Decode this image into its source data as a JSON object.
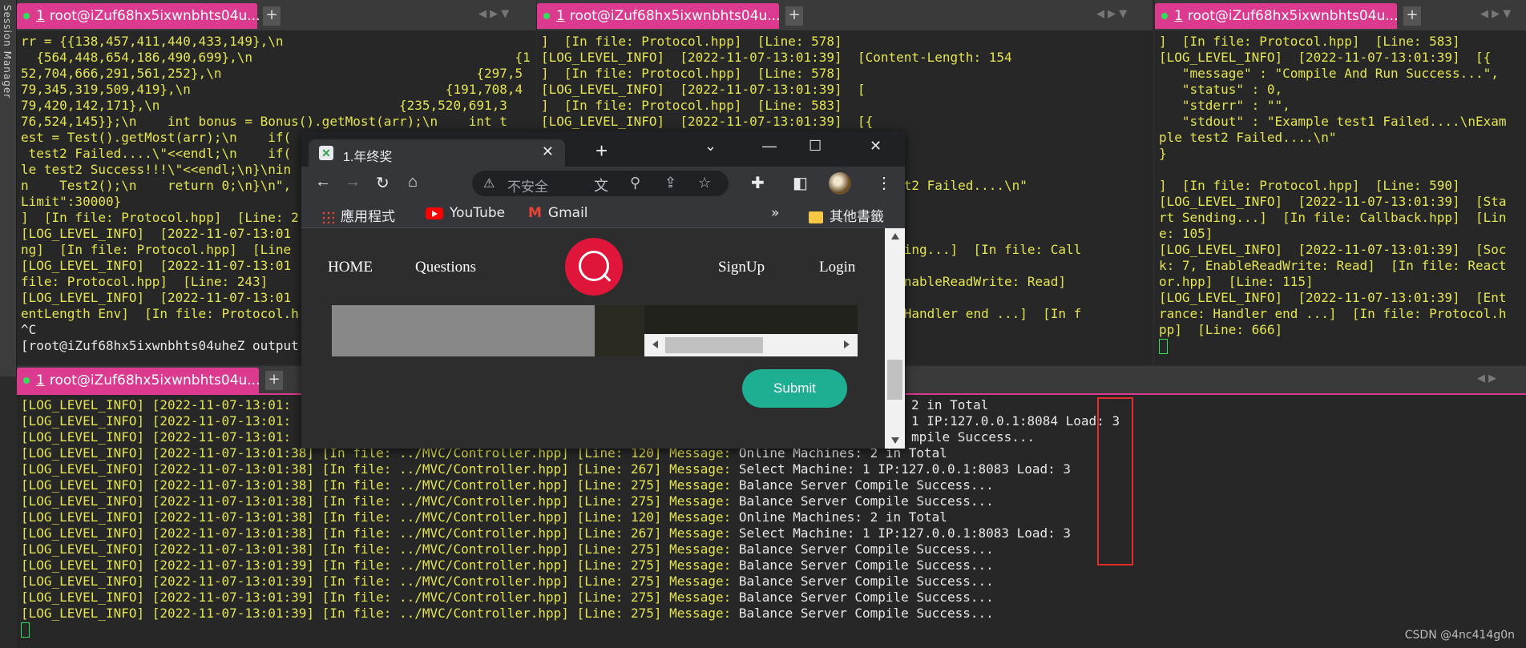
{
  "session_manager": {
    "label": "Session Manager"
  },
  "panes": {
    "top_left": {
      "tab": {
        "index": "1",
        "title": "root@iZuf68hx5ixwnbhts04u..."
      },
      "lines": [
        "rr = {{138,457,411,440,433,149},\\n",
        "  {564,448,654,186,490,699},\\n                                  {1",
        "52,704,666,291,561,252},\\n                                 {297,5",
        "79,345,319,509,419},\\n                                 {191,708,4",
        "79,420,142,171},\\n                               {235,520,691,3",
        "76,524,145}};\\n    int bonus = Bonus().getMost(arr);\\n    int t",
        "est = Test().getMost(arr);\\n    if(",
        " test2 Failed....\\\"<<endl;\\n    if(",
        "le test2 Success!!!\\\"<<endl;\\n}\\nin",
        "n    Test2();\\n    return 0;\\n}\\n\",",
        "Limit\":30000}",
        "]  [In file: Protocol.hpp]  [Line: 2",
        "[LOG_LEVEL_INFO]  [2022-11-07-13:01",
        "ng]  [In file: Protocol.hpp]  [Line",
        "[LOG_LEVEL_INFO]  [2022-11-07-13:01",
        "file: Protocol.hpp]  [Line: 243]",
        "[LOG_LEVEL_INFO]  [2022-11-07-13:01",
        "entLength Env]  [In file: Protocol.h",
        "^C"
      ],
      "prompt": "[root@iZuf68hx5ixwnbhts04uheZ output"
    },
    "top_mid": {
      "tab": {
        "index": "1",
        "title": "root@iZuf68hx5ixwnbhts04u..."
      },
      "lines": [
        "]  [In file: Protocol.hpp]  [Line: 578]",
        "[LOG_LEVEL_INFO]  [2022-11-07-13:01:39]  [Content-Length: 154",
        "]  [In file: Protocol.hpp]  [Line: 578]",
        "[LOG_LEVEL_INFO]  [2022-11-07-13:01:39]  [",
        "]  [In file: Protocol.hpp]  [Line: 583]",
        "[LOG_LEVEL_INFO]  [2022-11-07-13:01:39]  [{",
        "",
        "",
        "",
        "                                        ple test2 Failed....\\n\"",
        "",
        "",
        "",
        "                                        rt Sending...]  [In file: Call",
        "",
        "                                        k: 9, EnableReadWrite: Read]",
        "",
        "                                        rance: Handler end ...]  [In f"
      ]
    },
    "top_right": {
      "tab": {
        "index": "1",
        "title": "root@iZuf68hx5ixwnbhts04u..."
      },
      "lines": [
        "]  [In file: Protocol.hpp]  [Line: 583]",
        "[LOG_LEVEL_INFO]  [2022-11-07-13:01:39]  [{",
        "   \"message\" : \"Compile And Run Success...\",",
        "   \"status\" : 0,",
        "   \"stderr\" : \"\",",
        "   \"stdout\" : \"Example test1 Failed....\\nExam",
        "ple test2 Failed....\\n\"",
        "}",
        "",
        "]  [In file: Protocol.hpp]  [Line: 590]",
        "[LOG_LEVEL_INFO]  [2022-11-07-13:01:39]  [Sta",
        "rt Sending...]  [In file: Callback.hpp]  [Lin",
        "e: 105]",
        "[LOG_LEVEL_INFO]  [2022-11-07-13:01:39]  [Soc",
        "k: 7, EnableReadWrite: Read]  [In file: React",
        "or.hpp]  [Line: 115]",
        "[LOG_LEVEL_INFO]  [2022-11-07-13:01:39]  [Ent",
        "rance: Handler end ...]  [In file: Protocol.h",
        "pp]  [Line: 666]"
      ]
    },
    "bottom": {
      "tab": {
        "index": "1",
        "title": "root@iZuf68hx5ixwnbhts04u..."
      },
      "rows": [
        {
          "l": "[LOG_LEVEL_INFO] [2022-11-07-13:01:",
          "m": "",
          "r": "2 in Total"
        },
        {
          "l": "[LOG_LEVEL_INFO] [2022-11-07-13:01:",
          "m": "",
          "r": "1 IP:127.0.0.1:8084 Load: 3"
        },
        {
          "l": "[LOG_LEVEL_INFO] [2022-11-07-13:01:",
          "m": "",
          "r": "mpile Success..."
        },
        {
          "l": "[LOG_LEVEL_INFO] [2022-11-07-13:01:38] [In file: ../MVC/Controller.hpp] [Line: 120] Message:",
          "m": " Online Machines: 2 in Total",
          "r": ""
        },
        {
          "l": "[LOG_LEVEL_INFO] [2022-11-07-13:01:38] [In file: ../MVC/Controller.hpp] [Line: 267] Message:",
          "m": " Select Machine: 1 IP:127.0.0.1:8083 Load: 3",
          "r": ""
        },
        {
          "l": "[LOG_LEVEL_INFO] [2022-11-07-13:01:38] [In file: ../MVC/Controller.hpp] [Line: 275] Message:",
          "m": " Balance Server Compile Success...",
          "r": ""
        },
        {
          "l": "[LOG_LEVEL_INFO] [2022-11-07-13:01:38] [In file: ../MVC/Controller.hpp] [Line: 275] Message:",
          "m": " Balance Server Compile Success...",
          "r": ""
        },
        {
          "l": "[LOG_LEVEL_INFO] [2022-11-07-13:01:38] [In file: ../MVC/Controller.hpp] [Line: 120] Message:",
          "m": " Online Machines: 2 in Total",
          "r": ""
        },
        {
          "l": "[LOG_LEVEL_INFO] [2022-11-07-13:01:38] [In file: ../MVC/Controller.hpp] [Line: 267] Message:",
          "m": " Select Machine: 1 IP:127.0.0.1:8083 Load: 3",
          "r": ""
        },
        {
          "l": "[LOG_LEVEL_INFO] [2022-11-07-13:01:38] [In file: ../MVC/Controller.hpp] [Line: 275] Message:",
          "m": " Balance Server Compile Success...",
          "r": ""
        },
        {
          "l": "[LOG_LEVEL_INFO] [2022-11-07-13:01:39] [In file: ../MVC/Controller.hpp] [Line: 275] Message:",
          "m": " Balance Server Compile Success...",
          "r": ""
        },
        {
          "l": "[LOG_LEVEL_INFO] [2022-11-07-13:01:39] [In file: ../MVC/Controller.hpp] [Line: 275] Message:",
          "m": " Balance Server Compile Success...",
          "r": ""
        },
        {
          "l": "[LOG_LEVEL_INFO] [2022-11-07-13:01:39] [In file: ../MVC/Controller.hpp] [Line: 275] Message:",
          "m": " Balance Server Compile Success...",
          "r": ""
        },
        {
          "l": "[LOG_LEVEL_INFO] [2022-11-07-13:01:39] [In file: ../MVC/Controller.hpp] [Line: 275] Message:",
          "m": " Balance Server Compile Success...",
          "r": ""
        }
      ]
    }
  },
  "browser": {
    "tab_title": "1.年终奖",
    "address": "不安全",
    "bookmarks": {
      "apps": "應用程式",
      "youtube": "YouTube",
      "gmail": "Gmail",
      "more": "»",
      "other": "其他書籤"
    },
    "site": {
      "nav_home": "HOME",
      "nav_questions": "Questions",
      "nav_signup": "SignUp",
      "nav_login": "Login",
      "submit": "Submit"
    }
  },
  "watermark": "CSDN @4nc414g0n",
  "colors": {
    "tab_active": "#dc3a8e",
    "terminal_text": "#e4e453",
    "highlight_box": "#e02e2e",
    "submit": "#1eae92",
    "logo": "#e0153a"
  }
}
